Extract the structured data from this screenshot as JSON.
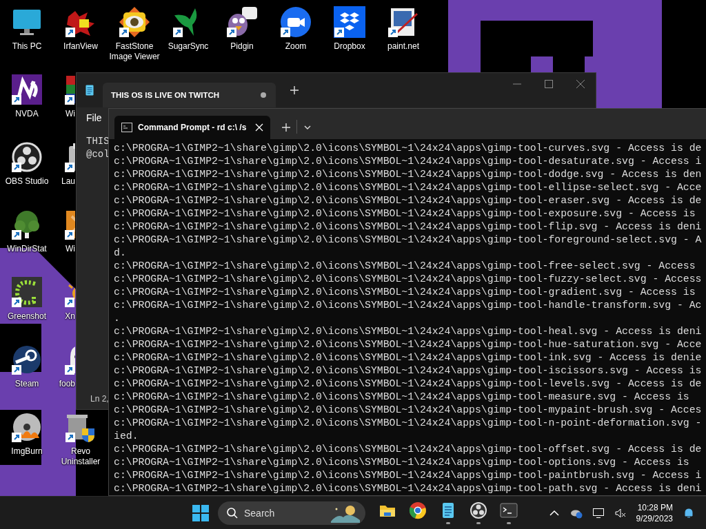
{
  "desktop": {
    "icon_columns": [
      [
        {
          "label": "This PC",
          "shortcut": false,
          "covered": false
        },
        {
          "label": "NVDA",
          "shortcut": true,
          "covered": false
        },
        {
          "label": "OBS Studio",
          "shortcut": true,
          "covered": false
        },
        {
          "label": "WinDirStat",
          "shortcut": true,
          "covered": false
        },
        {
          "label": "Greenshot",
          "shortcut": true,
          "covered": false
        },
        {
          "label": "Steam",
          "shortcut": true,
          "covered": false
        },
        {
          "label": "ImgBurn",
          "shortcut": true,
          "covered": false
        }
      ],
      [
        {
          "label": "IrfanView",
          "shortcut": true,
          "covered": false
        },
        {
          "label": "Wi",
          "shortcut": true,
          "covered": true
        },
        {
          "label": "Lau",
          "shortcut": true,
          "covered": true
        },
        {
          "label": "Wi",
          "shortcut": true,
          "covered": true
        },
        {
          "label": "Xn",
          "shortcut": true,
          "covered": true
        },
        {
          "label": "foob",
          "shortcut": true,
          "covered": true
        },
        {
          "label": "Revo Uninstaller",
          "shortcut": true,
          "covered": false
        }
      ],
      [
        {
          "label": "FastStone Image Viewer",
          "shortcut": true,
          "covered": false
        }
      ],
      [
        {
          "label": "SugarSync",
          "shortcut": true,
          "covered": false
        }
      ],
      [
        {
          "label": "Pidgin",
          "shortcut": true,
          "covered": false
        }
      ],
      [
        {
          "label": "Zoom",
          "shortcut": true,
          "covered": false
        }
      ],
      [
        {
          "label": "Dropbox",
          "shortcut": true,
          "covered": false
        }
      ],
      [
        {
          "label": "paint.net",
          "shortcut": true,
          "covered": false
        }
      ]
    ]
  },
  "notepad": {
    "tab": {
      "title": "THIS OS IS LIVE ON TWITCH",
      "modified": true
    },
    "menu": [
      "File"
    ],
    "lines": [
      "THIS",
      "@col"
    ],
    "status": "Ln 2,"
  },
  "terminal": {
    "tab": {
      "title": "Command Prompt - rd  c:\\ /s"
    },
    "lines": [
      "c:\\PROGRA~1\\GIMP2~1\\share\\gimp\\2.0\\icons\\SYMBOL~1\\24x24\\apps\\gimp-tool-curves.svg - Access is de",
      "c:\\PROGRA~1\\GIMP2~1\\share\\gimp\\2.0\\icons\\SYMBOL~1\\24x24\\apps\\gimp-tool-desaturate.svg - Access i",
      "c:\\PROGRA~1\\GIMP2~1\\share\\gimp\\2.0\\icons\\SYMBOL~1\\24x24\\apps\\gimp-tool-dodge.svg - Access is den",
      "c:\\PROGRA~1\\GIMP2~1\\share\\gimp\\2.0\\icons\\SYMBOL~1\\24x24\\apps\\gimp-tool-ellipse-select.svg - Acce",
      "c:\\PROGRA~1\\GIMP2~1\\share\\gimp\\2.0\\icons\\SYMBOL~1\\24x24\\apps\\gimp-tool-eraser.svg - Access is de",
      "c:\\PROGRA~1\\GIMP2~1\\share\\gimp\\2.0\\icons\\SYMBOL~1\\24x24\\apps\\gimp-tool-exposure.svg - Access is",
      "c:\\PROGRA~1\\GIMP2~1\\share\\gimp\\2.0\\icons\\SYMBOL~1\\24x24\\apps\\gimp-tool-flip.svg - Access is deni",
      "c:\\PROGRA~1\\GIMP2~1\\share\\gimp\\2.0\\icons\\SYMBOL~1\\24x24\\apps\\gimp-tool-foreground-select.svg - A",
      "d.",
      "c:\\PROGRA~1\\GIMP2~1\\share\\gimp\\2.0\\icons\\SYMBOL~1\\24x24\\apps\\gimp-tool-free-select.svg - Access",
      "c:\\PROGRA~1\\GIMP2~1\\share\\gimp\\2.0\\icons\\SYMBOL~1\\24x24\\apps\\gimp-tool-fuzzy-select.svg - Access",
      "c:\\PROGRA~1\\GIMP2~1\\share\\gimp\\2.0\\icons\\SYMBOL~1\\24x24\\apps\\gimp-tool-gradient.svg - Access is",
      "c:\\PROGRA~1\\GIMP2~1\\share\\gimp\\2.0\\icons\\SYMBOL~1\\24x24\\apps\\gimp-tool-handle-transform.svg - Ac",
      ".",
      "c:\\PROGRA~1\\GIMP2~1\\share\\gimp\\2.0\\icons\\SYMBOL~1\\24x24\\apps\\gimp-tool-heal.svg - Access is deni",
      "c:\\PROGRA~1\\GIMP2~1\\share\\gimp\\2.0\\icons\\SYMBOL~1\\24x24\\apps\\gimp-tool-hue-saturation.svg - Acce",
      "c:\\PROGRA~1\\GIMP2~1\\share\\gimp\\2.0\\icons\\SYMBOL~1\\24x24\\apps\\gimp-tool-ink.svg - Access is denie",
      "c:\\PROGRA~1\\GIMP2~1\\share\\gimp\\2.0\\icons\\SYMBOL~1\\24x24\\apps\\gimp-tool-iscissors.svg - Access is",
      "c:\\PROGRA~1\\GIMP2~1\\share\\gimp\\2.0\\icons\\SYMBOL~1\\24x24\\apps\\gimp-tool-levels.svg - Access is de",
      "c:\\PROGRA~1\\GIMP2~1\\share\\gimp\\2.0\\icons\\SYMBOL~1\\24x24\\apps\\gimp-tool-measure.svg - Access is",
      "c:\\PROGRA~1\\GIMP2~1\\share\\gimp\\2.0\\icons\\SYMBOL~1\\24x24\\apps\\gimp-tool-mypaint-brush.svg - Acces",
      "c:\\PROGRA~1\\GIMP2~1\\share\\gimp\\2.0\\icons\\SYMBOL~1\\24x24\\apps\\gimp-tool-n-point-deformation.svg -",
      "ied.",
      "c:\\PROGRA~1\\GIMP2~1\\share\\gimp\\2.0\\icons\\SYMBOL~1\\24x24\\apps\\gimp-tool-offset.svg - Access is de",
      "c:\\PROGRA~1\\GIMP2~1\\share\\gimp\\2.0\\icons\\SYMBOL~1\\24x24\\apps\\gimp-tool-options.svg - Access is",
      "c:\\PROGRA~1\\GIMP2~1\\share\\gimp\\2.0\\icons\\SYMBOL~1\\24x24\\apps\\gimp-tool-paintbrush.svg - Access i",
      "c:\\PROGRA~1\\GIMP2~1\\share\\gimp\\2.0\\icons\\SYMBOL~1\\24x24\\apps\\gimp-tool-path.svg - Access is deni"
    ]
  },
  "taskbar": {
    "search": {
      "placeholder": "Search"
    },
    "apps": [
      {
        "running": false
      },
      {
        "running": false
      },
      {
        "running": true
      },
      {
        "running": true
      },
      {
        "running": true
      }
    ],
    "time": "10:28 PM",
    "date": "9/29/2023"
  }
}
